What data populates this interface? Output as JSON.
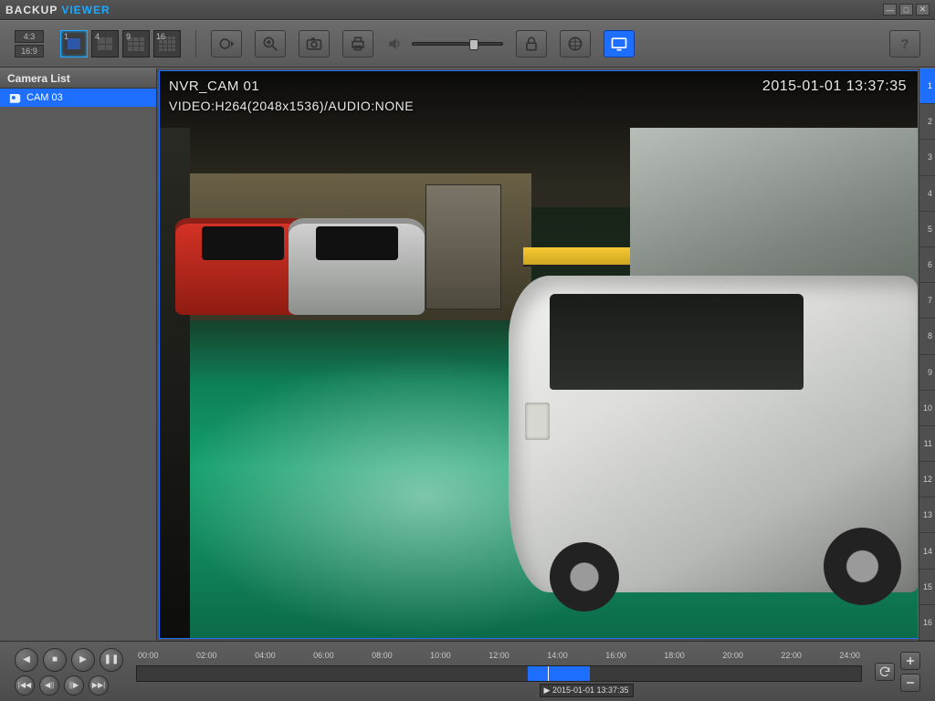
{
  "title": {
    "part1": "BACKUP",
    "part2": "VIEWER"
  },
  "toolbar": {
    "aspect": [
      "4:3",
      "16:9"
    ],
    "layouts": [
      "1",
      "4",
      "9",
      "16"
    ],
    "selected_layout": "1"
  },
  "sidebar": {
    "header": "Camera List",
    "items": [
      {
        "label": "CAM 03",
        "selected": true
      }
    ]
  },
  "overlay": {
    "camera": "NVR_CAM 01",
    "codec": "VIDEO:H264(2048x1536)/AUDIO:NONE",
    "timestamp": "2015-01-01 13:37:35"
  },
  "channels": [
    "1",
    "2",
    "3",
    "4",
    "5",
    "6",
    "7",
    "8",
    "9",
    "10",
    "11",
    "12",
    "13",
    "14",
    "15",
    "16"
  ],
  "selected_channel": "1",
  "timeline": {
    "labels": [
      "00:00",
      "02:00",
      "04:00",
      "06:00",
      "08:00",
      "10:00",
      "12:00",
      "14:00",
      "16:00",
      "18:00",
      "20:00",
      "22:00",
      "24:00"
    ],
    "segment_start_pct": 54.0,
    "segment_end_pct": 62.5,
    "cursor_pct": 56.8,
    "cursor_label": "▶ 2015-01-01 13:37:35"
  }
}
